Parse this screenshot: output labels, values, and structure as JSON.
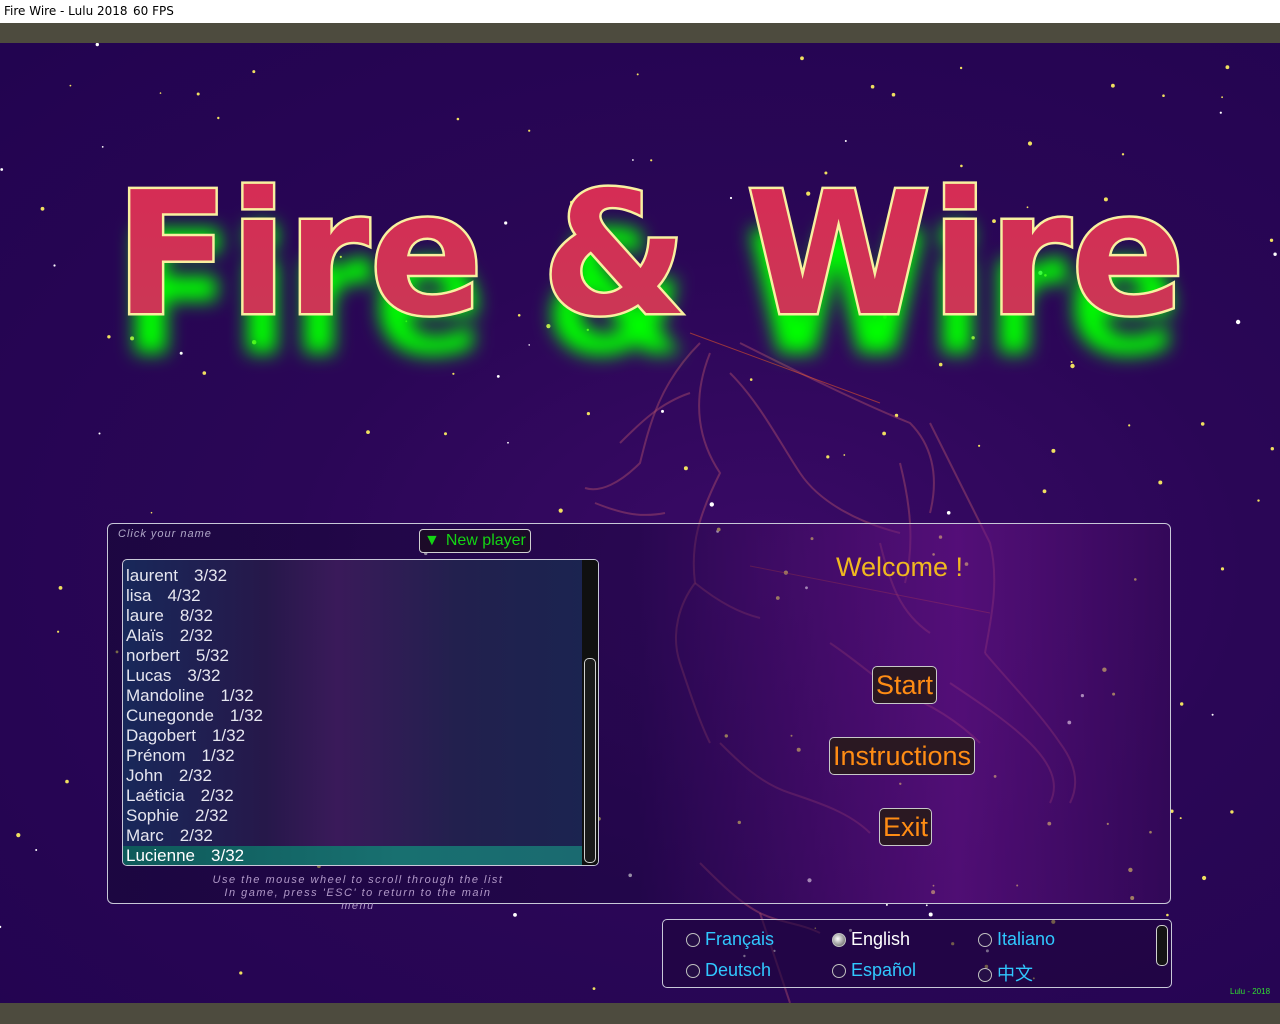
{
  "window": {
    "title": "Fire Wire - Lulu 2018",
    "fps": "60 FPS"
  },
  "logo": {
    "text": "Fire & Wire"
  },
  "players_panel": {
    "hint": "Click your name",
    "new_player_label": "New player",
    "players": [
      {
        "name": "laurent",
        "score": "3/32"
      },
      {
        "name": "lisa",
        "score": "4/32"
      },
      {
        "name": "laure",
        "score": "8/32"
      },
      {
        "name": "Alaïs",
        "score": "2/32"
      },
      {
        "name": "norbert",
        "score": "5/32"
      },
      {
        "name": "Lucas",
        "score": "3/32"
      },
      {
        "name": "Mandoline",
        "score": "1/32"
      },
      {
        "name": "Cunegonde",
        "score": "1/32"
      },
      {
        "name": "Dagobert",
        "score": "1/32"
      },
      {
        "name": "Prénom",
        "score": "1/32"
      },
      {
        "name": "John",
        "score": "2/32"
      },
      {
        "name": "Laéticia",
        "score": "2/32"
      },
      {
        "name": "Sophie",
        "score": "2/32"
      },
      {
        "name": "Marc",
        "score": "2/32"
      },
      {
        "name": "Lucienne",
        "score": "3/32",
        "selected": true
      }
    ],
    "footer_line1": "Use the mouse wheel to scroll through the list",
    "footer_line2": "In game, press 'ESC' to return to the main menu"
  },
  "main_menu": {
    "welcome": "Welcome !",
    "start_label": "Start",
    "instructions_label": "Instructions",
    "exit_label": "Exit"
  },
  "languages": [
    {
      "label": "Français",
      "selected": false
    },
    {
      "label": "English",
      "selected": true
    },
    {
      "label": "Italiano",
      "selected": false
    },
    {
      "label": "Deutsch",
      "selected": false
    },
    {
      "label": "Español",
      "selected": false
    },
    {
      "label": "中文",
      "selected": false
    }
  ],
  "credit": "Lulu - 2018",
  "colors": {
    "background": "#2a0656",
    "logo_fill": "#d8325a",
    "logo_outline": "#f8f0a0",
    "logo_glow": "#00ff00",
    "menu_text": "#ff8c14",
    "welcome_text": "#f0b820",
    "new_player_text": "#14d414",
    "language_text": "#30c8ff"
  }
}
